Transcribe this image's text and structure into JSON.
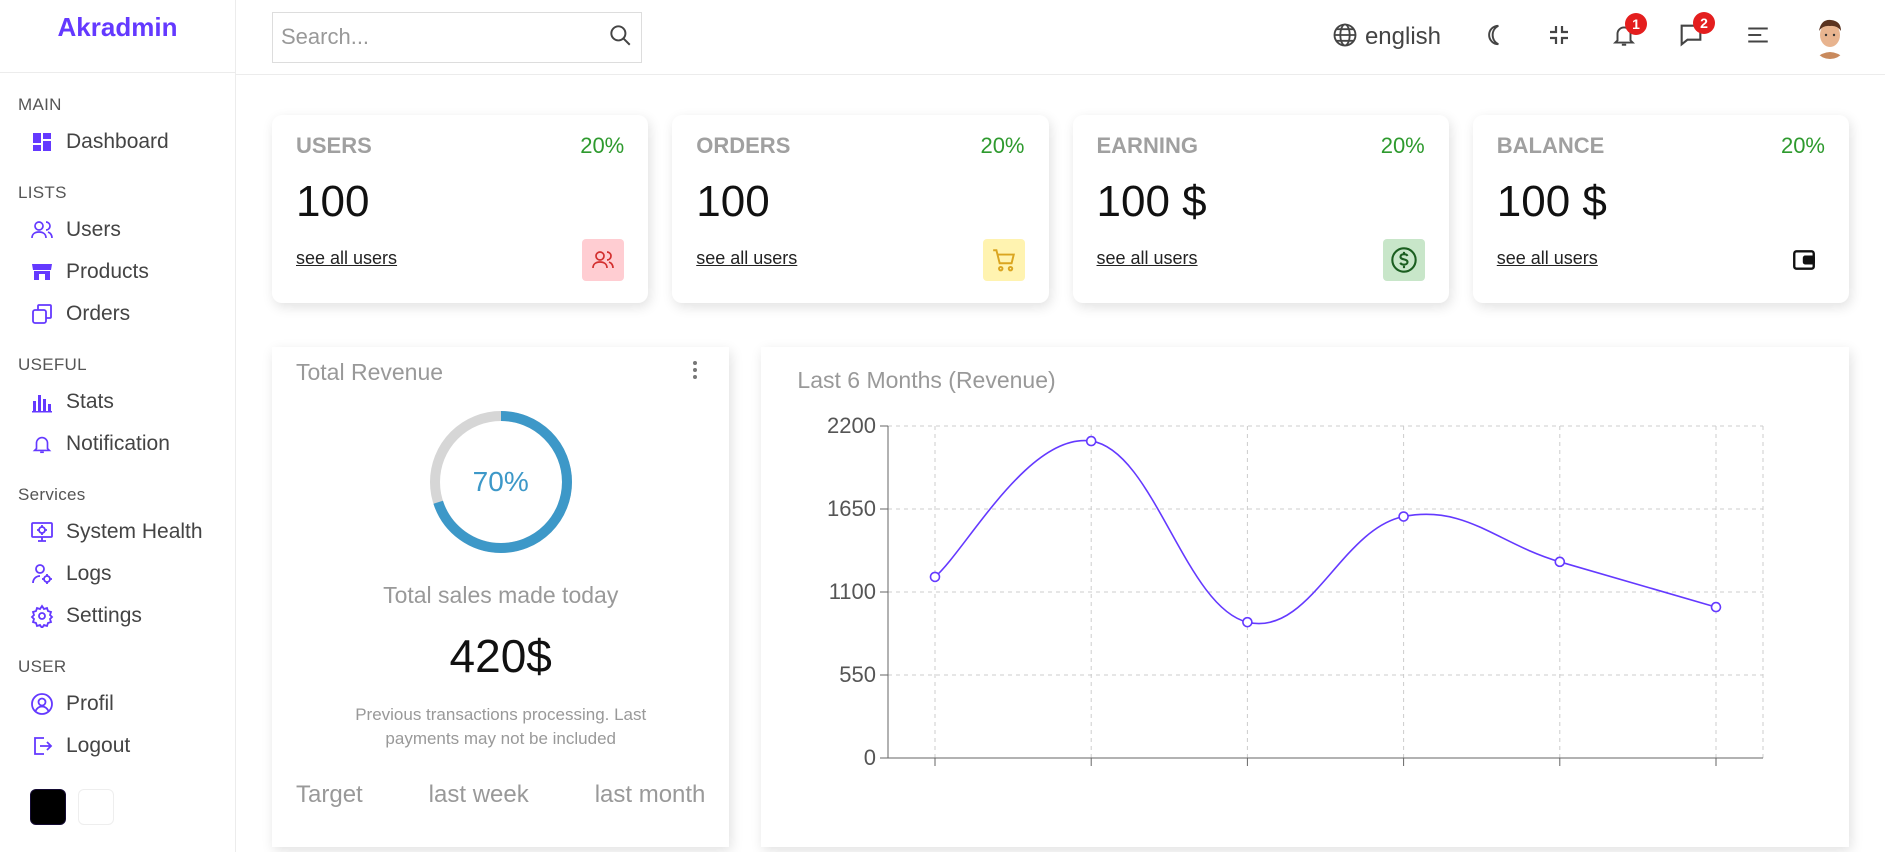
{
  "sidebar": {
    "logo": "Akradmin",
    "sections": [
      {
        "title": "MAIN",
        "items": [
          {
            "label": "Dashboard",
            "icon": "dashboard-icon"
          }
        ]
      },
      {
        "title": "LISTS",
        "items": [
          {
            "label": "Users",
            "icon": "users-icon"
          },
          {
            "label": "Products",
            "icon": "store-icon"
          },
          {
            "label": "Orders",
            "icon": "orders-icon"
          }
        ]
      },
      {
        "title": "USEFUL",
        "items": [
          {
            "label": "Stats",
            "icon": "stats-icon"
          },
          {
            "label": "Notification",
            "icon": "bell-icon"
          }
        ]
      },
      {
        "title": "Services",
        "items": [
          {
            "label": "System Health",
            "icon": "system-health-icon"
          },
          {
            "label": "Logs",
            "icon": "logs-icon"
          },
          {
            "label": "Settings",
            "icon": "settings-icon"
          }
        ]
      },
      {
        "title": "USER",
        "items": [
          {
            "label": "Profil",
            "icon": "profile-icon"
          },
          {
            "label": "Logout",
            "icon": "logout-icon"
          }
        ]
      }
    ],
    "color_options": [
      "#000000",
      "#ffffff"
    ]
  },
  "topbar": {
    "search_placeholder": "Search...",
    "language": "english",
    "notifications_count": "1",
    "messages_count": "2"
  },
  "widgets": [
    {
      "title": "USERS",
      "percent": "20%",
      "counter": "100",
      "link": "see all users",
      "icon": "users-icon",
      "icon_color": "#d32f2f",
      "icon_bg": "#ffcdd2"
    },
    {
      "title": "ORDERS",
      "percent": "20%",
      "counter": "100",
      "link": "see all users",
      "icon": "cart-icon",
      "icon_color": "#daa520",
      "icon_bg": "#fff3b0"
    },
    {
      "title": "EARNING",
      "percent": "20%",
      "counter": "100 $",
      "link": "see all users",
      "icon": "dollar-icon",
      "icon_color": "#1b5e20",
      "icon_bg": "#c8e6c9"
    },
    {
      "title": "BALANCE",
      "percent": "20%",
      "counter": "100 $",
      "link": "see all users",
      "icon": "wallet-icon",
      "icon_color": "#111111",
      "icon_bg": "#ffffff"
    }
  ],
  "featured": {
    "title": "Total Revenue",
    "progress_value": 70,
    "progress_label": "70%",
    "description": "Total sales made today",
    "amount": "420$",
    "note": "Previous transactions processing. Last payments may not be included",
    "summary": [
      "Target",
      "last week",
      "last month"
    ]
  },
  "chart": {
    "title": "Last 6 Months (Revenue)"
  },
  "chart_data": {
    "type": "line",
    "title": "Last 6 Months (Revenue)",
    "y_ticks": [
      0,
      550,
      1100,
      1650,
      2200
    ],
    "ylim": [
      0,
      2200
    ],
    "values": [
      1200,
      2100,
      900,
      1600,
      1300,
      1000
    ],
    "grid": true,
    "line_color": "#6439ff"
  },
  "colors": {
    "accent": "#6439ff",
    "positive": "#2e9a2e",
    "badge": "#e41e1e",
    "progress": "#3d98c8"
  }
}
